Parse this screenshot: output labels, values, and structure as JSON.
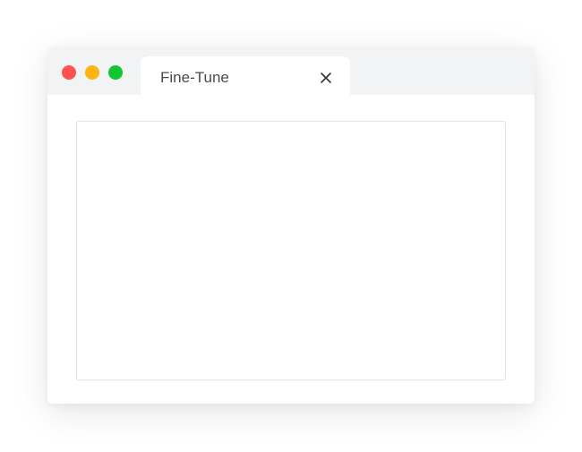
{
  "window": {
    "traffic_lights": {
      "close_color": "#fe5150",
      "minimize_color": "#fdb40f",
      "maximize_color": "#11c530"
    },
    "tab": {
      "title": "Fine-Tune",
      "close_icon": "close-icon"
    }
  },
  "colors": {
    "titlebar": "#f1f3f5",
    "content": "#ffffff",
    "panel_border": "#e4e4e4"
  }
}
